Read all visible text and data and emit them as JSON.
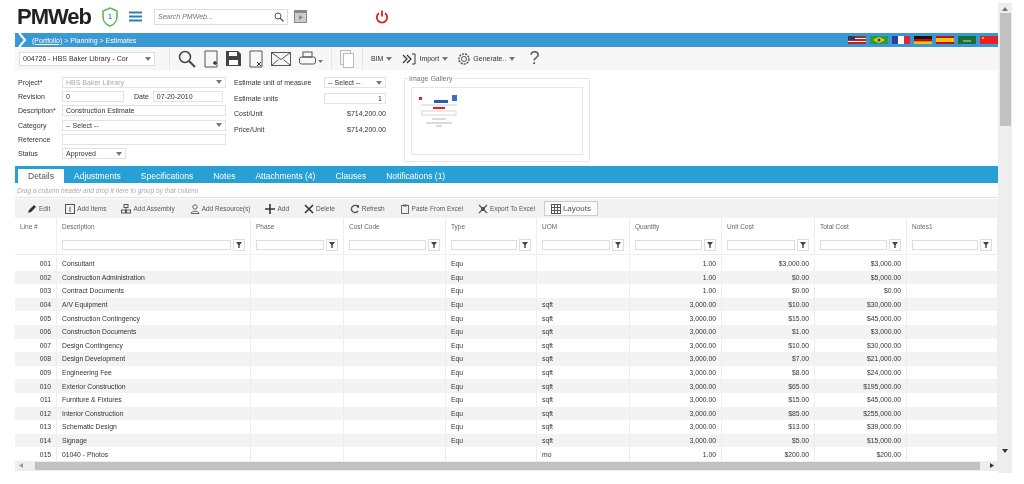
{
  "header": {
    "logo": "PMWeb",
    "badge": "1",
    "search": {
      "placeholder": "Search PMWeb..."
    }
  },
  "breadcrumb": {
    "link": "(Portfolio)",
    "path": " > Planning > Estimates"
  },
  "record_select": {
    "value": "004726 - HBS Baker Library - Cor"
  },
  "toolbar": {
    "menus": [
      "BIM",
      "Import",
      "Generate.."
    ],
    "help": "?"
  },
  "form": {
    "left": [
      {
        "label": "Project*",
        "kind": "select",
        "value": "HBS Baker Library",
        "disabled": true
      },
      {
        "label": "Revision",
        "kind": "input",
        "value": "0",
        "extra_label": "Date",
        "extra_value": "07-20-2010"
      },
      {
        "label": "Description*",
        "kind": "input",
        "value": "Construction Estimate"
      },
      {
        "label": "Category",
        "kind": "select",
        "value": "-- Select --",
        "disabled": false
      },
      {
        "label": "Reference",
        "kind": "input"
      },
      {
        "label": "Status",
        "kind": "short_select",
        "value": "Approved",
        "disabled": false
      }
    ],
    "middle": [
      {
        "label": "Estimate unit of measure",
        "kind": "select",
        "value": "-- Select --"
      },
      {
        "label": "Estimate units",
        "kind": "input",
        "value": "1"
      },
      {
        "label": "Cost/Unit",
        "kind": "readonly",
        "value": "$714,200.00"
      },
      {
        "label": "Price/Unit",
        "kind": "readonly",
        "value": "$714,200.00"
      }
    ],
    "gallery": {
      "title": "Image Gallery"
    }
  },
  "tabs": [
    {
      "label": "Details",
      "selected": true
    },
    {
      "label": "Adjustments",
      "selected": false
    },
    {
      "label": "Specifications",
      "selected": false
    },
    {
      "label": "Notes",
      "selected": false
    },
    {
      "label": "Attachments (4)",
      "selected": false
    },
    {
      "label": "Clauses",
      "selected": false
    },
    {
      "label": "Notifications (1)",
      "selected": false
    }
  ],
  "group_hint": "Drag a column header and drop it here to group by that column",
  "grid_toolbar": [
    {
      "label": "Edit",
      "kind": "action"
    },
    {
      "label": "Add Items",
      "kind": "action"
    },
    {
      "label": "Add Assembly",
      "kind": "action"
    },
    {
      "label": "Add Resource(s)",
      "kind": "action"
    },
    {
      "label": "Add",
      "kind": "action"
    },
    {
      "label": "Delete",
      "kind": "action"
    },
    {
      "label": "Refresh",
      "kind": "action"
    },
    {
      "label": "Paste From Excel",
      "kind": "action"
    },
    {
      "label": "Export To Excel",
      "kind": "action"
    },
    {
      "label": "Layouts",
      "kind": "layout"
    }
  ],
  "table": {
    "columns": [
      {
        "label": "Line #"
      },
      {
        "label": "Description"
      },
      {
        "label": "Phase"
      },
      {
        "label": "Cost Code"
      },
      {
        "label": "Type"
      },
      {
        "label": "UOM"
      },
      {
        "label": "Quantity"
      },
      {
        "label": "Unit Cost"
      },
      {
        "label": "Total Cost"
      },
      {
        "label": "Notes1"
      }
    ],
    "rows": [
      {
        "cells": [
          "001",
          "Consultant",
          "",
          "",
          "Equ",
          "",
          "1.00",
          "$3,000.00",
          "$3,000.00",
          ""
        ]
      },
      {
        "cells": [
          "002",
          "Construction Administration",
          "",
          "",
          "Equ",
          "",
          "1.00",
          "$0.00",
          "$5,000.00",
          ""
        ]
      },
      {
        "cells": [
          "003",
          "Contract Documents",
          "",
          "",
          "Equ",
          "",
          "1.00",
          "$0.00",
          "$0.00",
          ""
        ]
      },
      {
        "cells": [
          "004",
          "A/V Equipment",
          "",
          "",
          "Equ",
          "sqft",
          "3,000.00",
          "$10.00",
          "$30,000.00",
          ""
        ]
      },
      {
        "cells": [
          "005",
          "Construction Contingency",
          "",
          "",
          "Equ",
          "sqft",
          "3,000.00",
          "$15.00",
          "$45,000.00",
          ""
        ]
      },
      {
        "cells": [
          "006",
          "Construction Documents",
          "",
          "",
          "Equ",
          "sqft",
          "3,000.00",
          "$1.00",
          "$3,000.00",
          ""
        ]
      },
      {
        "cells": [
          "007",
          "Design Contingency",
          "",
          "",
          "Equ",
          "sqft",
          "3,000.00",
          "$10.00",
          "$30,000.00",
          ""
        ]
      },
      {
        "cells": [
          "008",
          "Design Development",
          "",
          "",
          "Equ",
          "sqft",
          "3,000.00",
          "$7.00",
          "$21,000.00",
          ""
        ]
      },
      {
        "cells": [
          "009",
          "Engineering Fee",
          "",
          "",
          "Equ",
          "sqft",
          "3,000.00",
          "$8.00",
          "$24,000.00",
          ""
        ]
      },
      {
        "cells": [
          "010",
          "Exterior Construction",
          "",
          "",
          "Equ",
          "sqft",
          "3,000.00",
          "$65.00",
          "$195,000.00",
          ""
        ]
      },
      {
        "cells": [
          "011",
          "Furniture & Fixtures",
          "",
          "",
          "Equ",
          "sqft",
          "3,000.00",
          "$15.00",
          "$45,000.00",
          ""
        ]
      },
      {
        "cells": [
          "012",
          "Interior Construction",
          "",
          "",
          "Equ",
          "sqft",
          "3,000.00",
          "$85.00",
          "$255,000.00",
          ""
        ]
      },
      {
        "cells": [
          "013",
          "Schematic Design",
          "",
          "",
          "Equ",
          "sqft",
          "3,000.00",
          "$13.00",
          "$39,000.00",
          ""
        ]
      },
      {
        "cells": [
          "014",
          "Signage",
          "",
          "",
          "Equ",
          "sqft",
          "3,000.00",
          "$5.00",
          "$15,000.00",
          ""
        ]
      },
      {
        "cells": [
          "015",
          "01040 - Photos",
          "",
          "",
          "",
          "mo",
          "1.00",
          "$200.00",
          "$200.00",
          ""
        ]
      }
    ]
  }
}
